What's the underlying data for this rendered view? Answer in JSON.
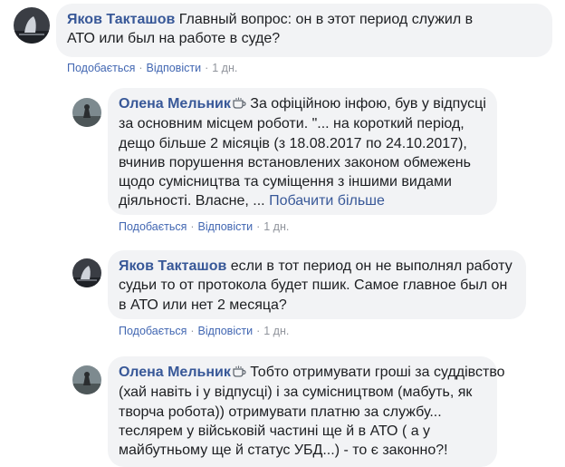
{
  "comments": [
    {
      "author": "Яков Такташов",
      "lines": [
        "Главный вопрос: он в этот период служил в",
        "АТО или был на работе в суде?"
      ],
      "actions": {
        "like": "Подобається",
        "reply": "Відповісти",
        "time": "1 дн."
      }
    },
    {
      "author": "Олена Мельник",
      "author_badge": "coffee-cup-icon",
      "lines": [
        "За офіційною інфою, був у відпусці",
        "за основним місцем роботи. \"... на короткий період,",
        "дещо більше 2 місяців (з 18.08.2017 по 24.10.2017),",
        "вчинив порушення встановлених законом обмежень",
        "щодо сумісництва та суміщення з іншими видами",
        "діяльності. Власне, ..."
      ],
      "see_more": "Побачити більше",
      "actions": {
        "like": "Подобається",
        "reply": "Відповісти",
        "time": "1 дн."
      }
    },
    {
      "author": "Яков Такташов",
      "lines": [
        "если в тот период он не выполнял работу",
        "судьи то от протокола будет пшик. Самое главное был он",
        "в АТО или нет 2 месяца?"
      ],
      "actions": {
        "like": "Подобається",
        "reply": "Відповісти",
        "time": "1 дн."
      }
    },
    {
      "author": "Олена Мельник",
      "author_badge": "coffee-cup-icon",
      "lines": [
        "Тобто отримувати гроші за суддівство",
        "(хай навіть і у відпусці) і за сумісництвом (мабуть, як",
        "творча робота)) отримувати платню за службу...",
        "теслярем у військовій частині ще й в АТО ( а у",
        "майбутньому ще й статус УБД...) - то є законно?!"
      ]
    }
  ],
  "separator": "·",
  "colors": {
    "bubble_bg": "#f2f3f5",
    "author": "#385898",
    "link": "#4267b2",
    "meta": "#90949c",
    "text": "#1c1e21"
  }
}
